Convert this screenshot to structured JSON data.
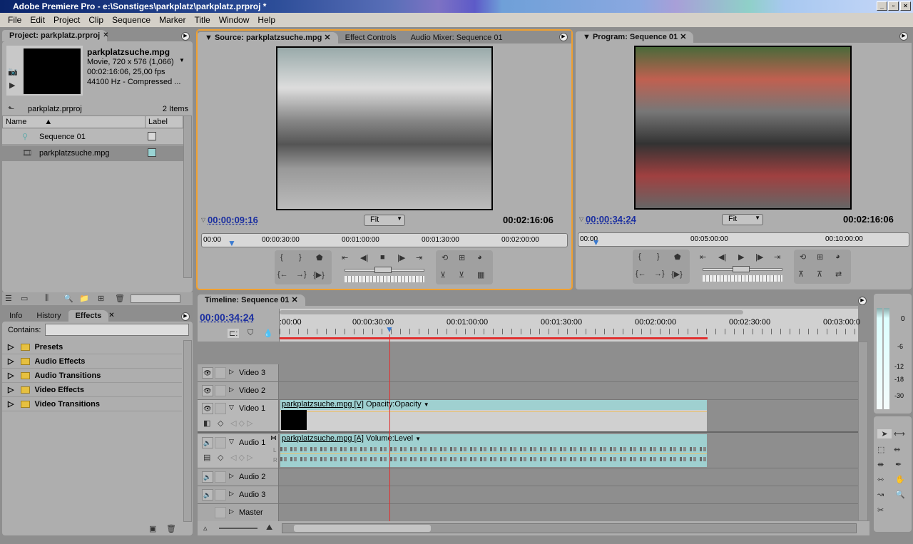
{
  "window": {
    "title": "Adobe Premiere Pro - e:\\Sonstiges\\parkplatz\\parkplatz.prproj *"
  },
  "menu": [
    "File",
    "Edit",
    "Project",
    "Clip",
    "Sequence",
    "Marker",
    "Title",
    "Window",
    "Help"
  ],
  "project": {
    "tab": "Project: parkplatz.prproj",
    "clip_name": "parkplatzsuche.mpg",
    "info1": "Movie, 720 x 576 (1,066)",
    "info2": "00:02:16:06, 25,00 fps",
    "info3": "44100 Hz - Compressed ...",
    "bin": "parkplatz.prproj",
    "count": "2 Items",
    "col_name": "Name",
    "col_label": "Label",
    "items": [
      {
        "name": "Sequence 01",
        "label_color": "#d8d8d8"
      },
      {
        "name": "parkplatzsuche.mpg",
        "label_color": "#9ad4d4"
      }
    ]
  },
  "effects": {
    "tabs": [
      "Info",
      "History",
      "Effects"
    ],
    "contains_label": "Contains:",
    "contains_value": "",
    "items": [
      "Presets",
      "Audio Effects",
      "Audio Transitions",
      "Video Effects",
      "Video Transitions"
    ]
  },
  "source": {
    "tabs": [
      "Source: parkplatzsuche.mpg",
      "Effect Controls",
      "Audio Mixer: Sequence 01"
    ],
    "timecode": "00:00:09:16",
    "zoom": "Fit",
    "duration": "00:02:16:06",
    "ruler": [
      "00:00",
      "00:00:30:00",
      "00:01:00:00",
      "00:01:30:00",
      "00:02:00:00"
    ],
    "playhead_fraction": 0.07
  },
  "program": {
    "tab": "Program: Sequence 01",
    "timecode": "00:00:34:24",
    "zoom": "Fit",
    "duration": "00:02:16:06",
    "ruler": [
      "00:00",
      "00:05:00:00",
      "00:10:00:00"
    ],
    "playhead_fraction": 0.04
  },
  "timeline": {
    "tab": "Timeline: Sequence 01",
    "timecode": "00:00:34:24",
    "ruler": [
      ":00:00",
      "00:00:30:00",
      "00:01:00:00",
      "00:01:30:00",
      "00:02:00:00",
      "00:02:30:00",
      "00:03:00:0"
    ],
    "video_tracks": [
      "Video 3",
      "Video 2",
      "Video 1"
    ],
    "audio_tracks": [
      "Audio 1",
      "Audio 2",
      "Audio 3",
      "Master"
    ],
    "video_clip": {
      "name": "parkplatzsuche.mpg [V]",
      "effect": "Opacity:Opacity"
    },
    "audio_clip": {
      "name": "parkplatzsuche.mpg [A]",
      "effect": "Volume:Level"
    },
    "clip_channels": [
      "L",
      "R"
    ]
  },
  "meters": {
    "scale": [
      "0",
      "-6",
      "-12",
      "-18",
      "-30"
    ]
  },
  "colors": {
    "accent_border": "#f0a030",
    "clip": "#9fd0d0",
    "playhead": "#e03030",
    "timecode": "#1a2ea0"
  }
}
